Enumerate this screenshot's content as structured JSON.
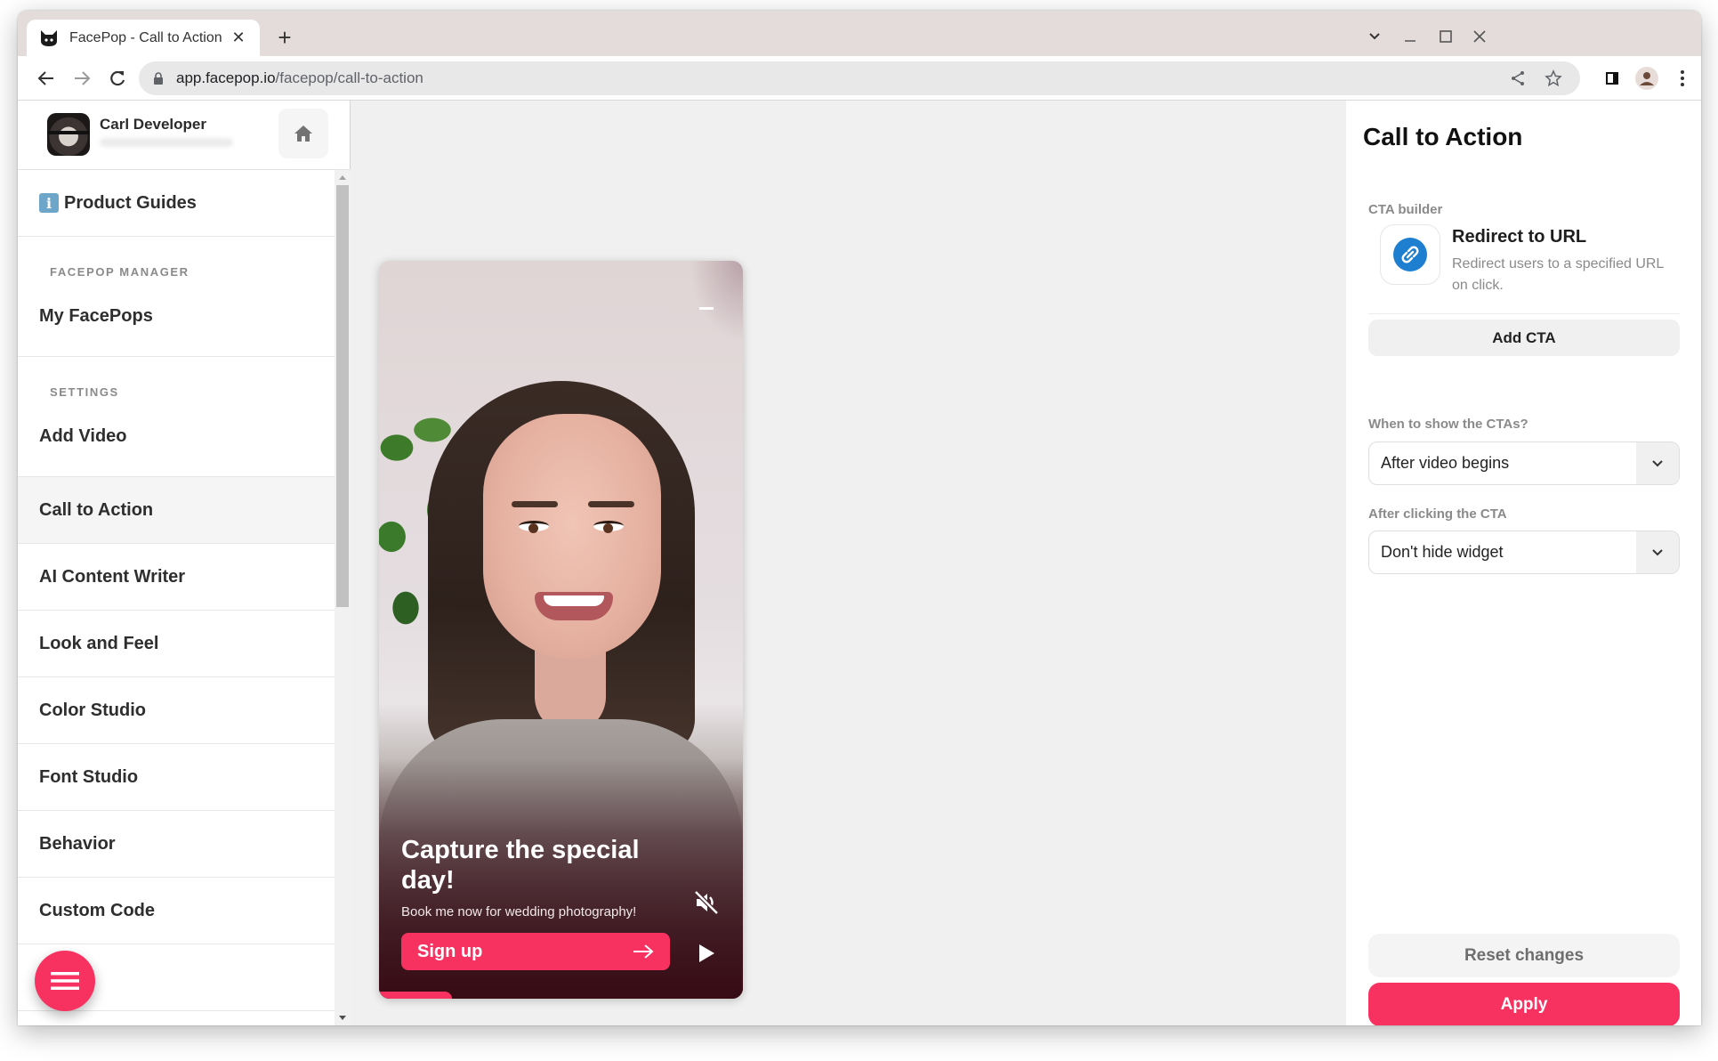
{
  "browser": {
    "tab_title": "FacePop - Call to Action",
    "url_host": "app.facepop.io",
    "url_path": "/facepop/call-to-action"
  },
  "sidebar": {
    "user_name": "Carl Developer",
    "product_guides": "Product Guides",
    "info_glyph": "i",
    "sections": [
      {
        "label": "FACEPOP MANAGER",
        "item": "My FacePops"
      },
      {
        "label": "SETTINGS",
        "item": "Add Video"
      }
    ],
    "items": [
      {
        "label": "Call to Action",
        "active": true
      },
      {
        "label": "AI Content Writer"
      },
      {
        "label": "Look and Feel"
      },
      {
        "label": "Color Studio"
      },
      {
        "label": "Font Studio"
      },
      {
        "label": "Behavior"
      },
      {
        "label": "Custom Code"
      }
    ]
  },
  "preview": {
    "title": "Capture the special day!",
    "subtitle": "Book me now for wedding photography!",
    "cta_label": "Sign up",
    "muted": true,
    "progress_fraction": 0.2
  },
  "panel": {
    "title": "Call to Action",
    "builder_label": "CTA builder",
    "cta": {
      "name": "Redirect to URL",
      "description": "Redirect users to a specified URL on click.",
      "icon": "link-icon"
    },
    "add_cta": "Add CTA",
    "when_label": "When to show the CTAs?",
    "when_value": "After video begins",
    "after_label": "After clicking the CTA",
    "after_value": "Don't hide widget",
    "reset": "Reset changes",
    "apply": "Apply"
  },
  "colors": {
    "accent": "#f73261",
    "link_icon": "#1e7fd0"
  }
}
